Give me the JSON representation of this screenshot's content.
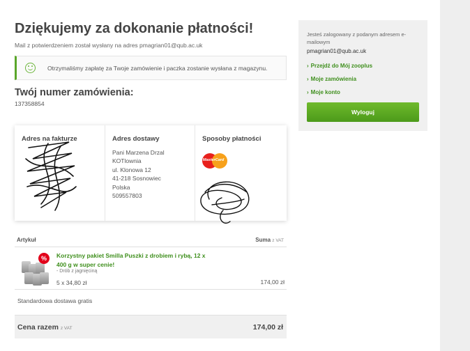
{
  "header": {
    "title": "Dziękujemy za dokonanie płatności!",
    "mail_note": "Mail z potwierdzeniem został wysłany na adres pmagrian01@qub.ac.uk"
  },
  "success_message": "Otrzymaliśmy zapłatę za Twoje zamówienie i paczka zostanie wysłana z magazynu.",
  "order": {
    "label": "Twój numer zamówienia:",
    "number": "137358854"
  },
  "addresses": {
    "billing": {
      "heading": "Adres na fakturze"
    },
    "shipping": {
      "heading": "Adres dostawy",
      "lines": [
        "Pani Marzena Drzal",
        "KOTlownia",
        "ul. Klonowa 12",
        "41-218 Sosnowiec",
        "Polska",
        "509557803"
      ]
    },
    "payment": {
      "heading": "Sposoby płatności",
      "card_brand": "MasterCard"
    }
  },
  "table": {
    "col_article": "Artykuł",
    "col_sum": "Suma",
    "col_sum_note": "z VAT"
  },
  "product": {
    "badge": "%",
    "name": "Korzystny pakiet Smilla Puszki z drobiem i rybą, 12 x 400 g w super cenie!",
    "variant": "- Drób z jagnięciną",
    "quantity_price": "5 x 34,80 zł",
    "sum": "174,00 zł"
  },
  "shipping_note": "Standardowa dostawa gratis",
  "total": {
    "label": "Cena razem",
    "note": "z VAT",
    "value": "174,00 zł"
  },
  "sidebar": {
    "info": "Jesteś zalogowany z podanym adresem e-mailowym",
    "email": "pmagrian01@qub.ac.uk",
    "links": [
      {
        "label": "Przejdź do Mój zooplus"
      },
      {
        "label": "Moje zamówienia"
      },
      {
        "label": "Moje konto"
      }
    ],
    "logout_label": "Wyloguj"
  },
  "colors": {
    "accent_green": "#4c9a1a",
    "link_green": "#3f8f1d",
    "badge_red": "#e2001a"
  }
}
